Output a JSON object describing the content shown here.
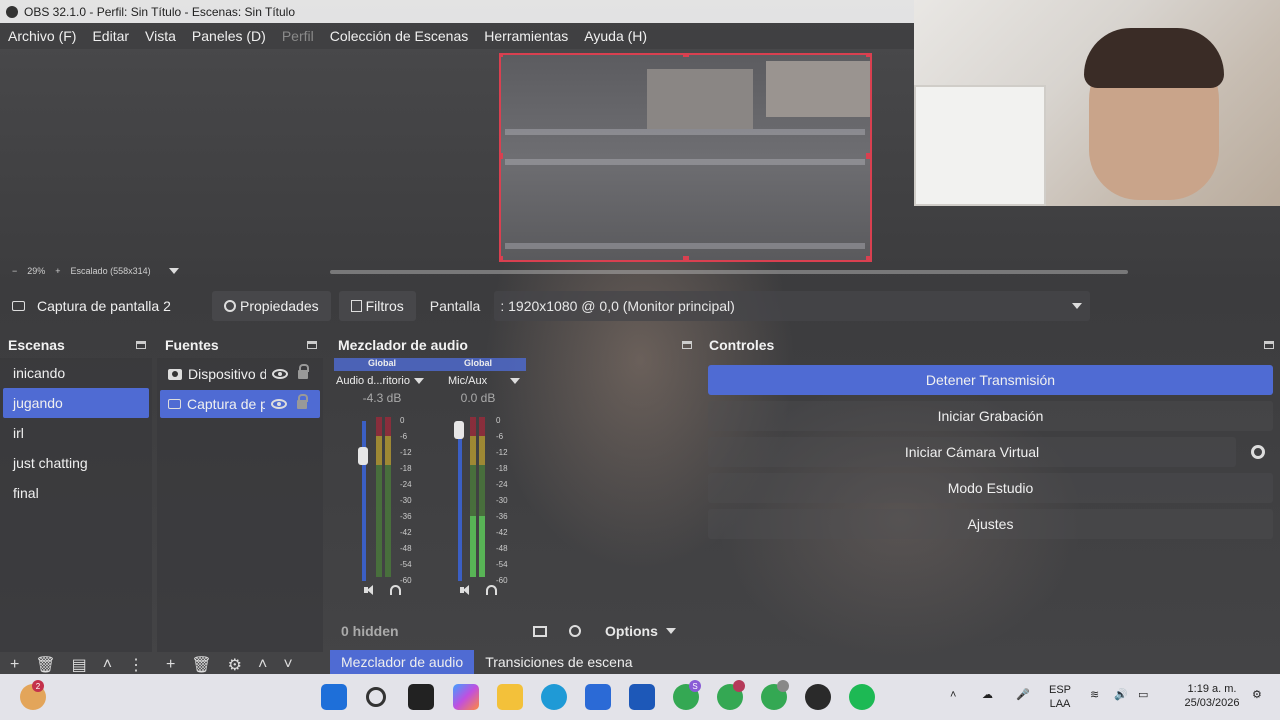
{
  "window": {
    "title": "OBS 32.1.0 - Perfil: Sin Título - Escenas: Sin Título"
  },
  "menu": {
    "items": [
      "Archivo (F)",
      "Editar",
      "Vista",
      "Paneles (D)",
      "Perfil",
      "Colección de Escenas",
      "Herramientas",
      "Ayuda (H)"
    ]
  },
  "zoom": {
    "minus": "−",
    "level": "29%",
    "plus": "+",
    "scaled": "Escalado (558x314)"
  },
  "source_bar": {
    "name": "Captura de pantalla 2",
    "properties": "Propiedades",
    "filters": "Filtros",
    "display_label": "Pantalla",
    "display_value": ": 1920x1080 @ 0,0 (Monitor principal)"
  },
  "scenes": {
    "title": "Escenas",
    "items": [
      "inicando",
      "jugando",
      "irl",
      "just chatting",
      "final"
    ],
    "selected": "jugando"
  },
  "sources": {
    "title": "Fuentes",
    "items": [
      "Dispositivo d",
      "Captura de p"
    ]
  },
  "mixer": {
    "title": "Mezclador de audio",
    "channels": [
      {
        "tag": "Global",
        "name": "Audio d...ritorio",
        "db": "-4.3 dB",
        "volume": 0.82
      },
      {
        "tag": "Global",
        "name": "Mic/Aux",
        "db": "0.0 dB",
        "volume": 1.0
      }
    ],
    "scale": [
      "0",
      "-6",
      "-12",
      "-18",
      "-24",
      "-30",
      "-36",
      "-42",
      "-48",
      "-54",
      "-60"
    ],
    "hidden": "0 hidden",
    "options": "Options"
  },
  "dock_tabs": [
    "Mezclador de audio",
    "Transiciones de escena"
  ],
  "controls": {
    "title": "Controles",
    "stop_stream": "Detener Transmisión",
    "start_recording": "Iniciar Grabación",
    "virtual_cam": "Iniciar Cámara Virtual",
    "studio_mode": "Modo Estudio",
    "settings": "Ajustes"
  },
  "taskbar": {
    "weather_badge": "2",
    "chrome_badges": [
      "S",
      "",
      ""
    ],
    "lang": "ESP",
    "layout": "LAA",
    "time": "1:19 a. m.",
    "date": "25/03/2026"
  },
  "colors": {
    "accent": "#4f6bd3",
    "preview_border": "#d94050"
  }
}
